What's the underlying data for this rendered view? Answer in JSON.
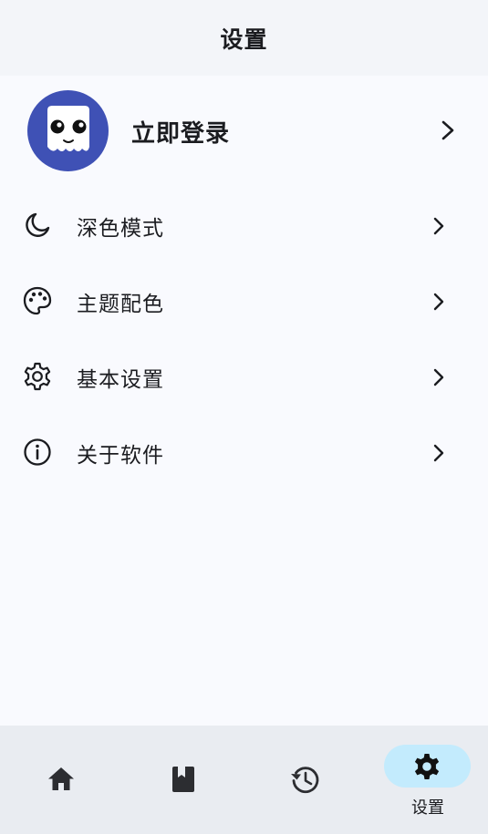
{
  "appbar": {
    "title": "设置"
  },
  "login": {
    "label": "立即登录",
    "avatar_icon": "ghost-mascot-icon"
  },
  "menu": {
    "items": [
      {
        "label": "深色模式",
        "icon": "moon-icon"
      },
      {
        "label": "主题配色",
        "icon": "palette-icon"
      },
      {
        "label": "基本设置",
        "icon": "gear-icon"
      },
      {
        "label": "关于软件",
        "icon": "info-icon"
      }
    ]
  },
  "bottom_nav": {
    "items": [
      {
        "icon": "home-icon",
        "label": ""
      },
      {
        "icon": "book-icon",
        "label": ""
      },
      {
        "icon": "history-icon",
        "label": ""
      },
      {
        "icon": "settings-icon",
        "label": "设置",
        "active": true
      }
    ]
  },
  "colors": {
    "appbar_bg": "#f3f5f9",
    "page_bg": "#f9fafe",
    "avatar_bg": "#3f51b5",
    "nav_bg": "#e9ecf1",
    "nav_active_pill": "#c3ebfd",
    "text": "#1b1c20"
  }
}
